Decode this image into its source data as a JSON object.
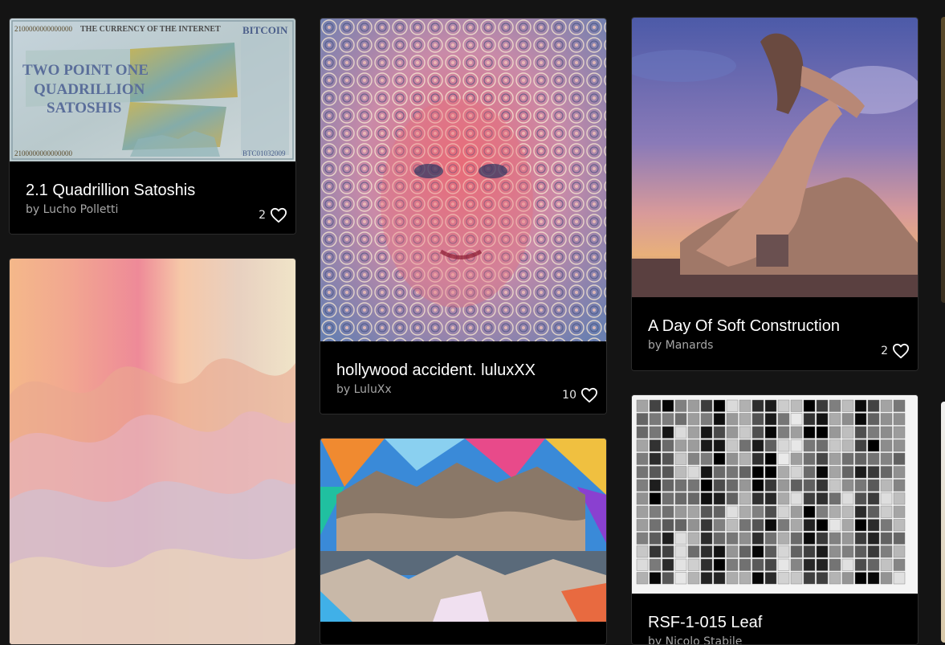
{
  "gallery": {
    "cards": [
      {
        "title": "2.1 Quadrillion Satoshis",
        "artist": "by Lucho Polletti",
        "likes": "2",
        "note": {
          "top_left": "2100000000000000",
          "top_center": "THE CURRENCY OF THE INTERNET",
          "brand": "BITCOIN",
          "headline_1": "TWO POINT ONE",
          "headline_2": "QUADRILLION",
          "headline_3": "SATOSHIS",
          "bottom_left": "2100000000000000",
          "serial": "BTC01032009"
        }
      },
      {
        "title": "hollywood accident. luluxXX",
        "artist": "by LuluXx",
        "likes": "10"
      },
      {
        "title": "A Day Of Soft Construction",
        "artist": "by Manards",
        "likes": "2"
      },
      {
        "title": "RSF-1-015 Leaf",
        "artist": "by Nicolo Stabile"
      }
    ]
  },
  "colors": {
    "background": "#141414",
    "card": "#000000",
    "title": "#ffffff",
    "artist": "#a6a6a6"
  },
  "icons": {
    "like": "heart-outline-icon"
  }
}
